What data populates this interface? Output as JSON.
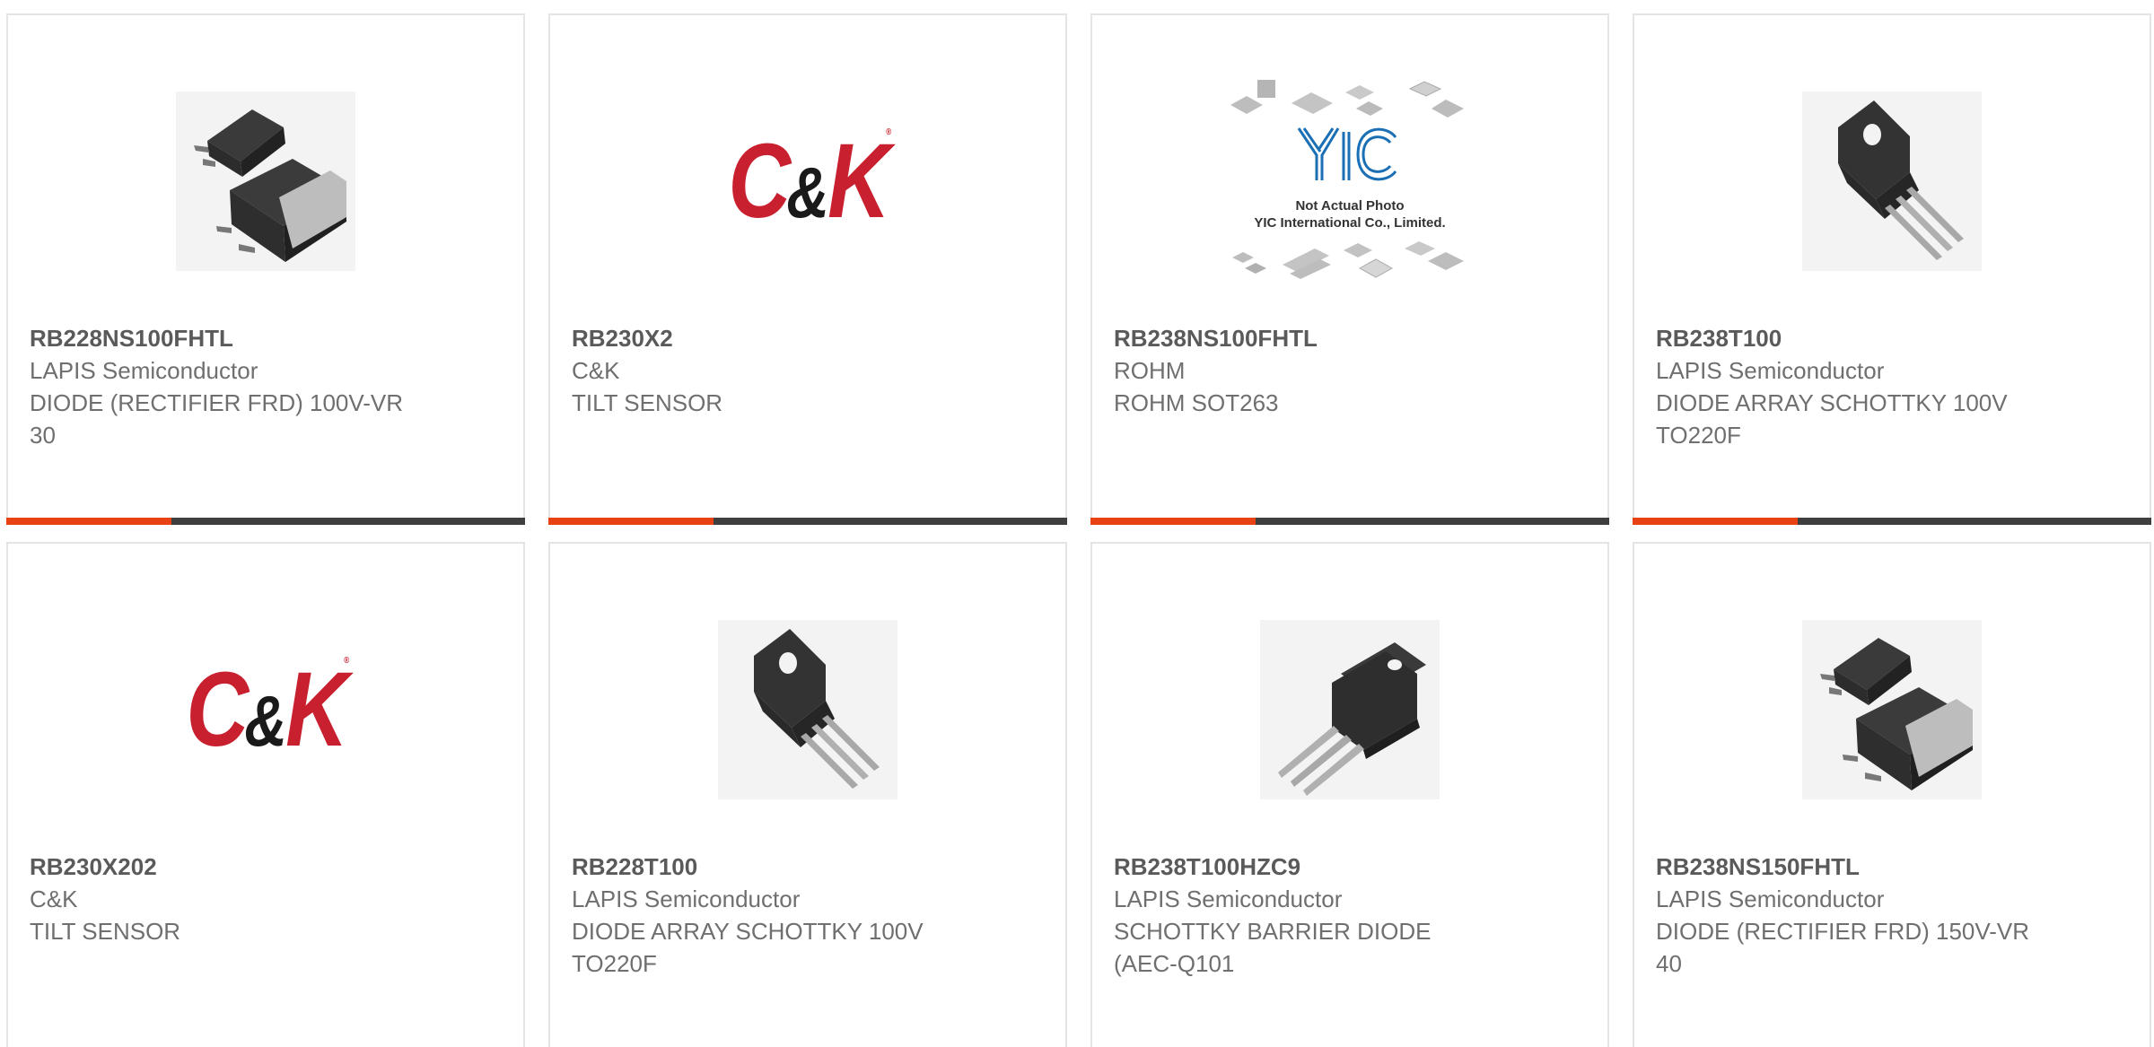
{
  "colors": {
    "accent": "#e84113",
    "bar": "#3e3e3e",
    "ck_red": "#c8202f",
    "ck_black": "#1a1a1a",
    "yic_blue": "#1a6fb5"
  },
  "products": [
    {
      "part_number": "RB228NS100FHTL",
      "manufacturer": "LAPIS Semiconductor",
      "description": "DIODE (RECTIFIER FRD) 100V-VR 30",
      "image": "dpak-package-icon"
    },
    {
      "part_number": "RB230X2",
      "manufacturer": "C&K",
      "description": "TILT SENSOR",
      "image": "ck-logo"
    },
    {
      "part_number": "RB238NS100FHTL",
      "manufacturer": "ROHM",
      "description": "ROHM SOT263",
      "image": "yic-placeholder",
      "placeholder_logo": "YIC",
      "placeholder_line1": "Not Actual Photo",
      "placeholder_line2": "YIC International Co., Limited."
    },
    {
      "part_number": "RB238T100",
      "manufacturer": "LAPIS Semiconductor",
      "description": "DIODE ARRAY SCHOTTKY 100V TO220F",
      "image": "to220f-package-icon"
    },
    {
      "part_number": "RB230X202",
      "manufacturer": "C&K",
      "description": "TILT SENSOR",
      "image": "ck-logo"
    },
    {
      "part_number": "RB228T100",
      "manufacturer": "LAPIS Semiconductor",
      "description": "DIODE ARRAY SCHOTTKY 100V TO220F",
      "image": "to220f-package-icon"
    },
    {
      "part_number": "RB238T100HZC9",
      "manufacturer": "LAPIS Semiconductor",
      "description": "SCHOTTKY BARRIER DIODE (AEC-Q101",
      "image": "to220-package-icon"
    },
    {
      "part_number": "RB238NS150FHTL",
      "manufacturer": "LAPIS Semiconductor",
      "description": "DIODE (RECTIFIER FRD) 150V-VR 40",
      "image": "dpak-package-icon"
    }
  ],
  "ck_logo": {
    "left": "C",
    "amp": "&",
    "right": "K",
    "mark": "®"
  }
}
